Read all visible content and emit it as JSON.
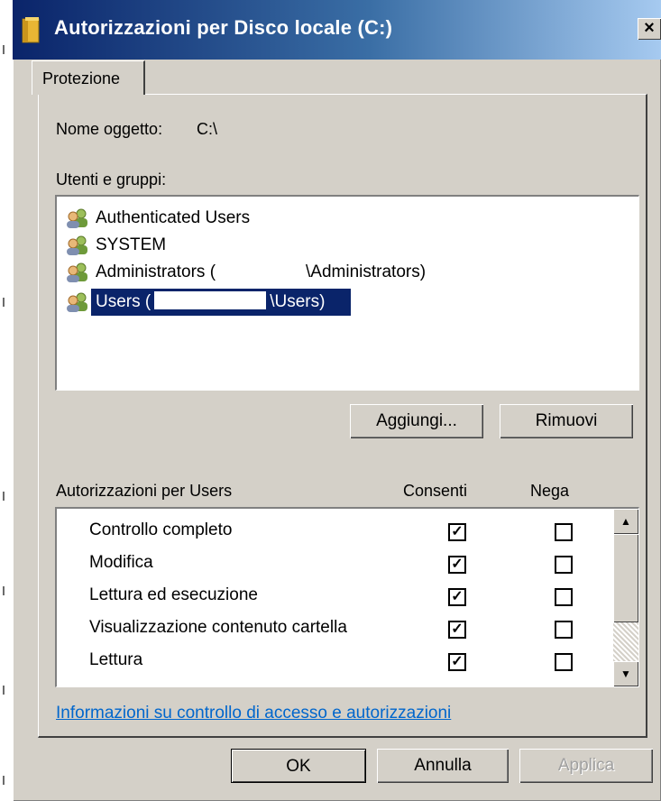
{
  "window": {
    "title": "Autorizzazioni per Disco locale (C:)",
    "close_glyph": "×"
  },
  "tabs": [
    {
      "label": "Protezione"
    }
  ],
  "object": {
    "label": "Nome oggetto:",
    "value": "C:\\"
  },
  "users_groups": {
    "label": "Utenti e gruppi:",
    "items": [
      {
        "text": "Authenticated Users",
        "selected": false
      },
      {
        "text": "SYSTEM",
        "selected": false
      },
      {
        "text": "Administrators (",
        "suffix": "\\Administrators)",
        "selected": false
      },
      {
        "text": "Users (",
        "suffix": "\\Users)",
        "selected": true
      }
    ]
  },
  "buttons": {
    "add": "Aggiungi...",
    "remove": "Rimuovi",
    "ok": "OK",
    "cancel": "Annulla",
    "apply": "Applica"
  },
  "permissions": {
    "header": "Autorizzazioni per Users",
    "allow_header": "Consenti",
    "deny_header": "Nega",
    "rows": [
      {
        "name": "Controllo completo",
        "allow": true,
        "deny": false
      },
      {
        "name": "Modifica",
        "allow": true,
        "deny": false
      },
      {
        "name": "Lettura ed esecuzione",
        "allow": true,
        "deny": false
      },
      {
        "name": "Visualizzazione contenuto cartella",
        "allow": true,
        "deny": false
      },
      {
        "name": "Lettura",
        "allow": true,
        "deny": false
      }
    ]
  },
  "help_link": "Informazioni su controllo di accesso e autorizzazioni",
  "checkmark": "✓",
  "colors": {
    "title_bar": "#0a246a",
    "selection": "#0a246a",
    "link": "#0066cc",
    "face": "#d4d0c8"
  },
  "icons": {
    "window": "folder-icon",
    "user_item": "users-group-icon"
  }
}
